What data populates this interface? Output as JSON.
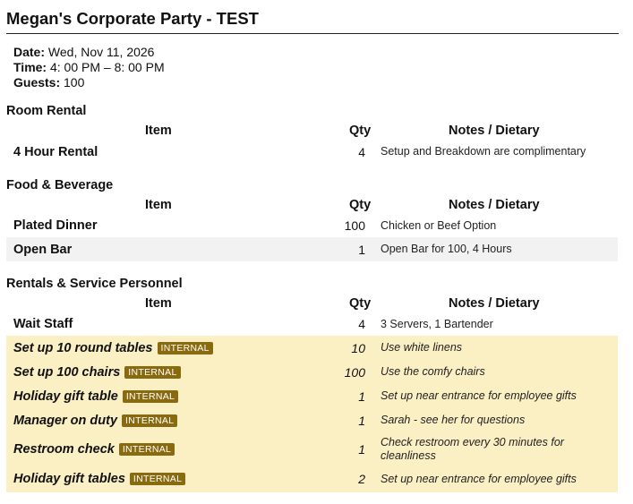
{
  "event": {
    "title": "Megan's Corporate Party - TEST",
    "date_label": "Date:",
    "date_value": "Wed, Nov 11, 2026",
    "time_label": "Time:",
    "time_value": "4: 00 PM – 8: 00 PM",
    "guests_label": "Guests:",
    "guests_value": "100"
  },
  "columns": {
    "item": "Item",
    "qty": "Qty",
    "notes": "Notes / Dietary"
  },
  "badge_label": "INTERNAL",
  "colors": {
    "internal_bg": "#fbefc4",
    "badge_bg": "#8a6a0f",
    "shade_bg": "#f2f2f2"
  },
  "sections": [
    {
      "title": "Room Rental",
      "rows": [
        {
          "item": "4 Hour Rental",
          "qty": "4",
          "notes": "Setup and Breakdown are complimentary"
        }
      ]
    },
    {
      "title": "Food & Beverage",
      "rows": [
        {
          "item": "Plated Dinner",
          "qty": "100",
          "notes": "Chicken or Beef Option"
        },
        {
          "item": "Open Bar",
          "qty": "1",
          "notes": "Open Bar for 100, 4 Hours"
        }
      ]
    },
    {
      "title": "Rentals & Service Personnel",
      "rows": [
        {
          "item": "Wait Staff",
          "qty": "4",
          "notes": "3 Servers, 1 Bartender"
        },
        {
          "item": "Set up 10 round tables",
          "qty": "10",
          "notes": "Use white linens"
        },
        {
          "item": "Set up 100 chairs",
          "qty": "100",
          "notes": "Use the comfy chairs"
        },
        {
          "item": "Holiday gift table",
          "qty": "1",
          "notes": "Set up near entrance for employee gifts"
        },
        {
          "item": "Manager on duty",
          "qty": "1",
          "notes": "Sarah - see her for questions"
        },
        {
          "item": "Restroom check",
          "qty": "1",
          "notes": "Check restroom every 30 minutes for cleanliness"
        },
        {
          "item": "Holiday gift tables",
          "qty": "2",
          "notes": "Set up near entrance for employee gifts"
        }
      ]
    }
  ]
}
